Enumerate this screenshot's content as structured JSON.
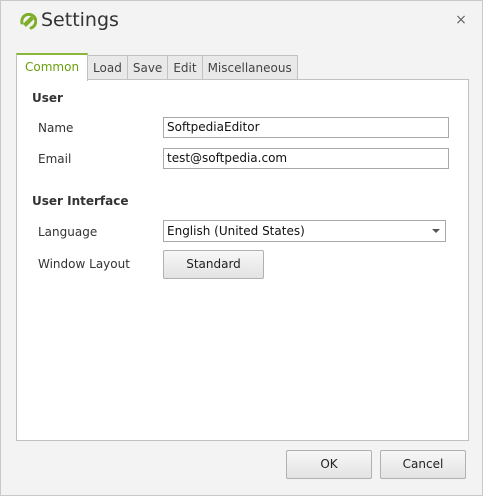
{
  "window": {
    "title": "Settings",
    "close_glyph": "×"
  },
  "tabs": [
    {
      "label": "Common",
      "active": true
    },
    {
      "label": "Load",
      "active": false
    },
    {
      "label": "Save",
      "active": false
    },
    {
      "label": "Edit",
      "active": false
    },
    {
      "label": "Miscellaneous",
      "active": false
    }
  ],
  "user": {
    "section_title": "User",
    "name_label": "Name",
    "name_value": "SoftpediaEditor",
    "email_label": "Email",
    "email_value": "test@softpedia.com"
  },
  "ui": {
    "section_title": "User Interface",
    "language_label": "Language",
    "language_value": "English (United States)",
    "layout_label": "Window Layout",
    "layout_button": "Standard"
  },
  "footer": {
    "ok_label": "OK",
    "cancel_label": "Cancel"
  },
  "colors": {
    "accent": "#6a9e10"
  },
  "icons": {
    "app": "edit-check-icon",
    "close": "close-icon",
    "dropdown": "chevron-down-icon"
  }
}
